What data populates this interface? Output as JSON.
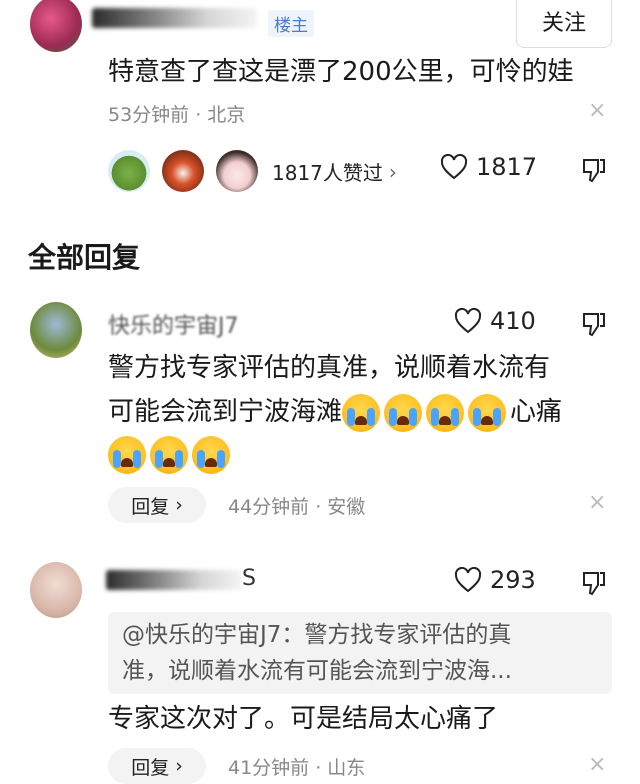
{
  "top_comment": {
    "author_badge": "楼主",
    "follow_label": "关注",
    "text": "特意查了查这是漂了200公里，可怜的娃",
    "meta": "53分钟前 · 北京",
    "likers_text": "1817人赞过",
    "like_count": "1817",
    "close_glyph": "×"
  },
  "section_title": "全部回复",
  "replies": [
    {
      "author": "快乐的宇宙J7",
      "like_count": "410",
      "text_line1": "警方找专家评估的真准，说顺着水流有",
      "text_line2_prefix": "可能会流到宁波海滩",
      "text_line2_suffix": "心痛",
      "meta": "44分钟前 · 安徽",
      "reply_label": "回复"
    },
    {
      "author": "S",
      "like_count": "293",
      "quote_line1": "@快乐的宇宙J7：警方找专家评估的真",
      "quote_line2": "准，说顺着水流有可能会流到宁波海...",
      "text": "专家这次对了。可是结局太心痛了",
      "meta": "41分钟前 · 山东",
      "reply_label": "回复"
    }
  ],
  "colors": {
    "accent_badge": "#4a7bd0",
    "meta_gray": "#888888",
    "reply_bg": "#f3f3f3"
  }
}
